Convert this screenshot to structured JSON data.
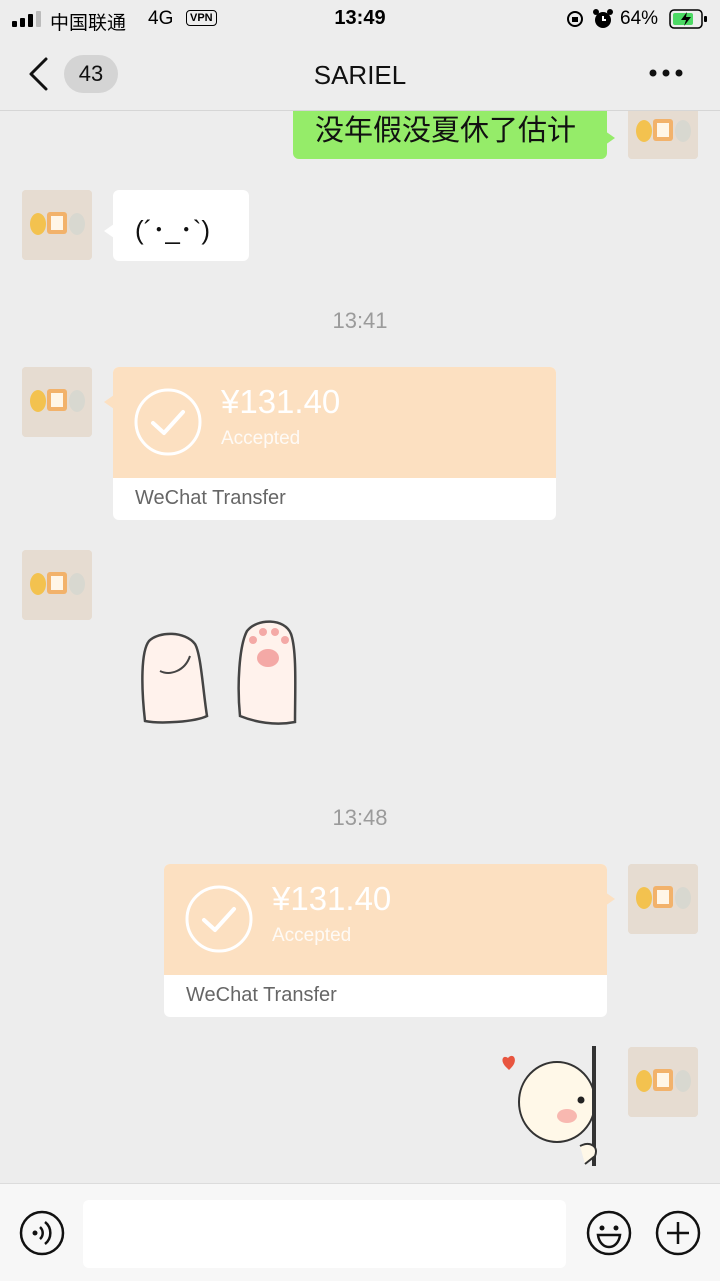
{
  "status_bar": {
    "carrier": "中国联通",
    "network": "4G",
    "vpn": "VPN",
    "time": "13:49",
    "battery": "64%"
  },
  "nav": {
    "unread_count": "43",
    "title": "SARIEL"
  },
  "messages": [
    {
      "type": "text",
      "side": "right",
      "text": "没年假没夏休了估计"
    },
    {
      "type": "text",
      "side": "left",
      "text": "(´･_･`)"
    },
    {
      "type": "timestamp",
      "text": "13:41"
    },
    {
      "type": "transfer",
      "side": "left",
      "amount": "¥131.40",
      "status": "Accepted",
      "footer": "WeChat Transfer"
    },
    {
      "type": "sticker",
      "side": "left",
      "icon": "paws-sticker-icon"
    },
    {
      "type": "timestamp",
      "text": "13:48"
    },
    {
      "type": "transfer",
      "side": "right",
      "amount": "¥131.40",
      "status": "Accepted",
      "footer": "WeChat Transfer"
    },
    {
      "type": "sticker",
      "side": "right",
      "icon": "peeking-heart-sticker-icon"
    }
  ],
  "colors": {
    "background": "#EDEDED",
    "sent_bubble": "#95EC69",
    "transfer": "#FCE0C1"
  }
}
